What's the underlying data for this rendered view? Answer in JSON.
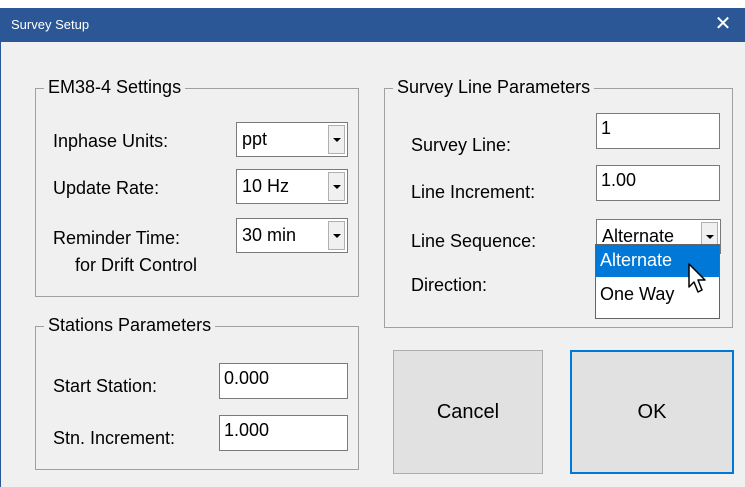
{
  "window": {
    "title": "Survey Setup"
  },
  "em38_settings": {
    "title": "EM38-4 Settings",
    "inphase_units": {
      "label": "Inphase Units:",
      "value": "ppt"
    },
    "update_rate": {
      "label": "Update Rate:",
      "value": "10 Hz"
    },
    "reminder_time": {
      "label": "Reminder Time:",
      "sublabel": "for Drift Control",
      "value": "30 min"
    }
  },
  "stations": {
    "title": "Stations Parameters",
    "start_station": {
      "label": "Start Station:",
      "value": "0.000"
    },
    "stn_increment": {
      "label": "Stn. Increment:",
      "value": "1.000"
    }
  },
  "survey_line": {
    "title": "Survey Line Parameters",
    "survey_line": {
      "label": "Survey Line:",
      "value": "1"
    },
    "line_increment": {
      "label": "Line Increment:",
      "value": "1.00"
    },
    "line_sequence": {
      "label": "Line Sequence:",
      "value": "Alternate",
      "options": [
        "Alternate",
        "One Way"
      ]
    },
    "direction": {
      "label": "Direction:"
    }
  },
  "buttons": {
    "cancel": "Cancel",
    "ok": "OK"
  },
  "colors": {
    "titlebar": "#2b5797",
    "selection": "#0078d7",
    "accent": "#0078d7"
  }
}
